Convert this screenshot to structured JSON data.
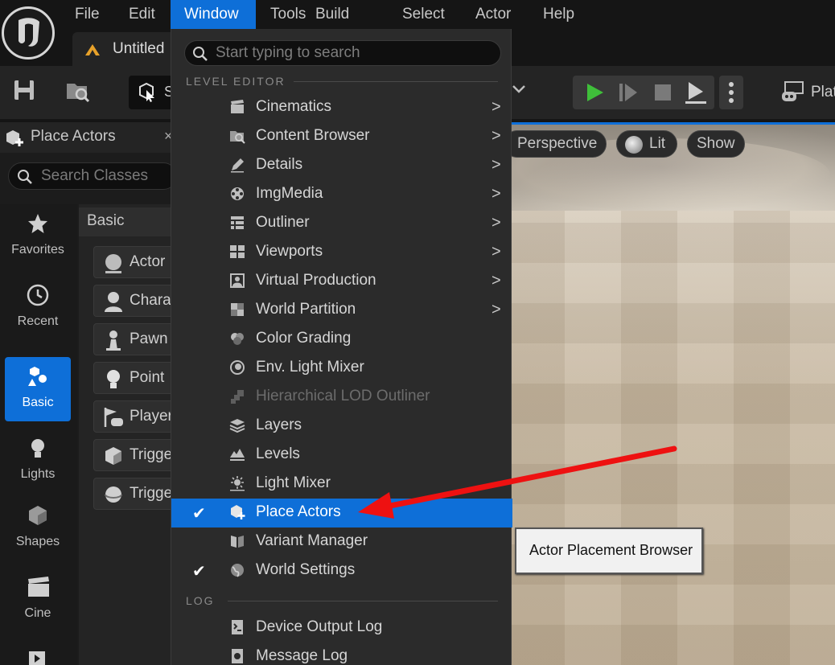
{
  "menubar": {
    "items": [
      {
        "label": "File"
      },
      {
        "label": "Edit"
      },
      {
        "label": "Window"
      },
      {
        "label": "Tools"
      },
      {
        "label": "Build"
      },
      {
        "label": "Select"
      },
      {
        "label": "Actor"
      },
      {
        "label": "Help"
      }
    ],
    "active": "Window"
  },
  "document_tab": {
    "label": "Untitled"
  },
  "toolbar": {
    "select_mode_label": "S",
    "platforms_label": "Plat"
  },
  "place_actors_panel": {
    "title": "Place Actors",
    "close_glyph": "×",
    "search_placeholder": "Search Classes",
    "categories": [
      {
        "label": "Favorites",
        "icon": "star-icon"
      },
      {
        "label": "Recent",
        "icon": "clock-icon"
      },
      {
        "label": "Basic",
        "icon": "basic-shapes-icon",
        "active": true
      },
      {
        "label": "Lights",
        "icon": "lightbulb-icon"
      },
      {
        "label": "Shapes",
        "icon": "cube-icon"
      },
      {
        "label": "Cine",
        "icon": "clapper-icon"
      }
    ],
    "section_title": "Basic",
    "items": [
      {
        "label": "Actor",
        "icon": "sphere-icon"
      },
      {
        "label": "Chara",
        "icon": "character-icon"
      },
      {
        "label": "Pawn",
        "icon": "pawn-icon"
      },
      {
        "label": "Point",
        "icon": "light-bulb-icon"
      },
      {
        "label": "Player",
        "icon": "player-start-icon"
      },
      {
        "label": "Trigge",
        "icon": "trigger-box-icon"
      },
      {
        "label": "Trigge",
        "icon": "trigger-sphere-icon"
      }
    ]
  },
  "viewport": {
    "perspective_label": "Perspective",
    "lit_label": "Lit",
    "show_label": "Show",
    "tooltip": "Actor Placement Browser"
  },
  "window_menu": {
    "search_placeholder": "Start typing to search",
    "section_level_editor": "LEVEL EDITOR",
    "section_log": "LOG",
    "items": [
      {
        "label": "Cinematics",
        "icon": "cinematics-icon",
        "submenu": ">",
        "checked": "",
        "state": "normal"
      },
      {
        "label": "Content Browser",
        "icon": "content-browser-icon",
        "submenu": ">",
        "checked": "",
        "state": "normal"
      },
      {
        "label": "Details",
        "icon": "details-icon",
        "submenu": ">",
        "checked": "",
        "state": "normal"
      },
      {
        "label": "ImgMedia",
        "icon": "imgmedia-icon",
        "submenu": ">",
        "checked": "",
        "state": "normal"
      },
      {
        "label": "Outliner",
        "icon": "outliner-icon",
        "submenu": ">",
        "checked": "",
        "state": "normal"
      },
      {
        "label": "Viewports",
        "icon": "viewports-icon",
        "submenu": ">",
        "checked": "",
        "state": "normal"
      },
      {
        "label": "Virtual Production",
        "icon": "virtual-production-icon",
        "submenu": ">",
        "checked": "",
        "state": "normal"
      },
      {
        "label": "World Partition",
        "icon": "world-partition-icon",
        "submenu": ">",
        "checked": "",
        "state": "normal"
      },
      {
        "label": "Color Grading",
        "icon": "color-grading-icon",
        "submenu": "",
        "checked": "",
        "state": "normal"
      },
      {
        "label": "Env. Light Mixer",
        "icon": "env-light-mixer-icon",
        "submenu": "",
        "checked": "",
        "state": "normal"
      },
      {
        "label": "Hierarchical LOD Outliner",
        "icon": "hlod-outliner-icon",
        "submenu": "",
        "checked": "",
        "state": "disabled"
      },
      {
        "label": "Layers",
        "icon": "layers-icon",
        "submenu": "",
        "checked": "",
        "state": "normal"
      },
      {
        "label": "Levels",
        "icon": "levels-icon",
        "submenu": "",
        "checked": "",
        "state": "normal"
      },
      {
        "label": "Light Mixer",
        "icon": "light-mixer-icon",
        "submenu": "",
        "checked": "",
        "state": "normal"
      },
      {
        "label": "Place Actors",
        "icon": "place-actors-icon",
        "submenu": "",
        "checked": "✔",
        "state": "highlight"
      },
      {
        "label": "Variant Manager",
        "icon": "variant-manager-icon",
        "submenu": "",
        "checked": "",
        "state": "normal"
      },
      {
        "label": "World Settings",
        "icon": "world-settings-icon",
        "submenu": "",
        "checked": "✔",
        "state": "normal"
      }
    ],
    "log_items": [
      {
        "label": "Device Output Log",
        "icon": "device-output-log-icon"
      },
      {
        "label": "Message Log",
        "icon": "message-log-icon"
      }
    ]
  },
  "colors": {
    "accent": "#0e6fd8",
    "menu_bg": "#2b2b2b",
    "annotation_arrow": "#ee1111"
  }
}
